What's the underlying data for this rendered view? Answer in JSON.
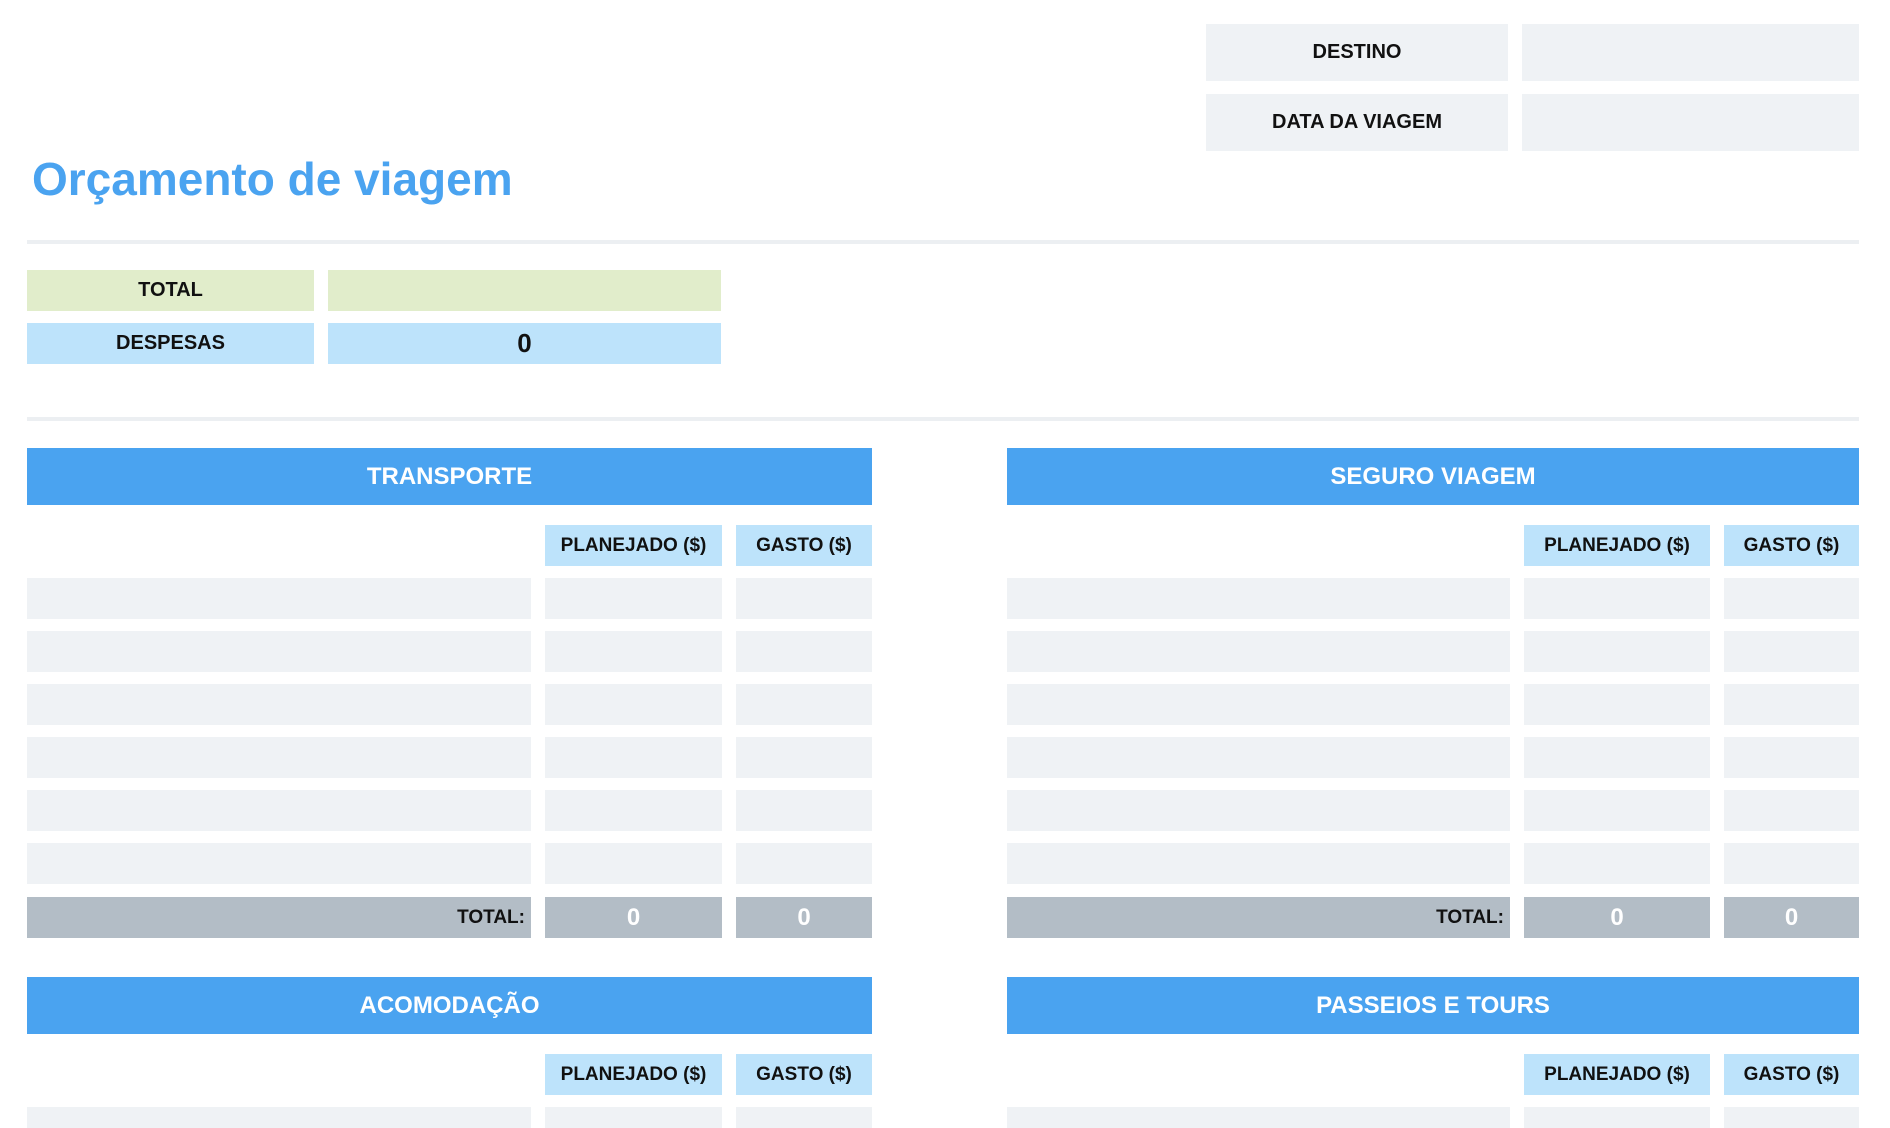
{
  "header": {
    "destination_label": "DESTINO",
    "destination_value": "",
    "trip_date_label": "DATA DA VIAGEM",
    "trip_date_value": ""
  },
  "title": "Orçamento de viagem",
  "summary": {
    "total_label": "TOTAL",
    "total_value": "",
    "expenses_label": "DESPESAS",
    "expenses_value": "0"
  },
  "sections": [
    {
      "title": "TRANSPORTE",
      "planned_header": "PLANEJADO ($)",
      "spent_header": "GASTO ($)",
      "total_label": "TOTAL:",
      "total_planned": "0",
      "total_spent": "0"
    },
    {
      "title": "SEGURO VIAGEM",
      "planned_header": "PLANEJADO ($)",
      "spent_header": "GASTO ($)",
      "total_label": "TOTAL:",
      "total_planned": "0",
      "total_spent": "0"
    },
    {
      "title": "ACOMODAÇÃO",
      "planned_header": "PLANEJADO ($)",
      "spent_header": "GASTO ($)"
    },
    {
      "title": "PASSEIOS E TOURS",
      "planned_header": "PLANEJADO ($)",
      "spent_header": "GASTO ($)"
    }
  ],
  "colors": {
    "accent": "#4aa3f0",
    "light_blue": "#bde3fb",
    "light_green": "#e1edcb",
    "cell_gray": "#eff2f5",
    "total_gray": "#b3bdc6"
  }
}
